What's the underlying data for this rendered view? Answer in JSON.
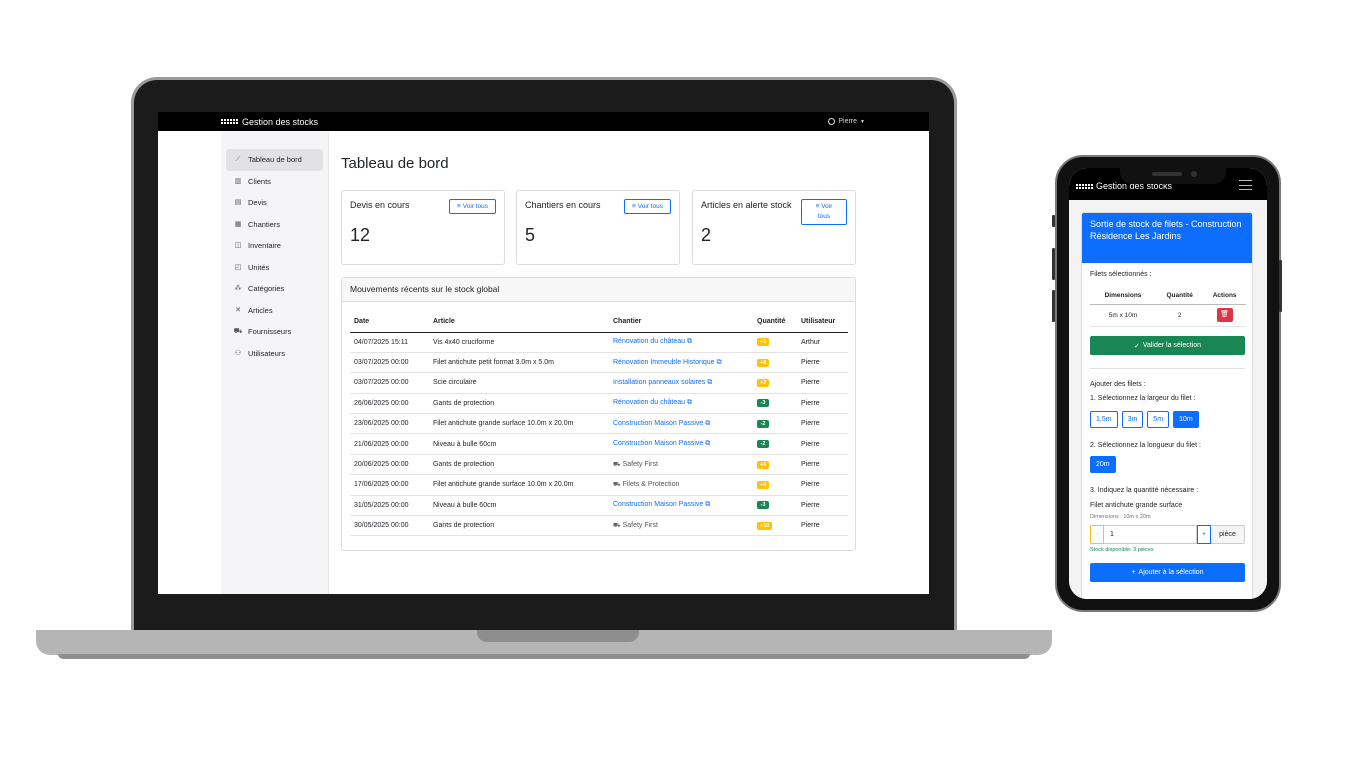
{
  "laptop": {
    "brand": "Gestion des stocks",
    "user": "Pierre",
    "sidebar": [
      {
        "label": "Tableau de bord",
        "icon": "chart-line-icon",
        "glyph": "⟋",
        "active": true
      },
      {
        "label": "Clients",
        "icon": "bar-chart-icon",
        "glyph": "▥"
      },
      {
        "label": "Devis",
        "icon": "document-icon",
        "glyph": "▤"
      },
      {
        "label": "Chantiers",
        "icon": "building-icon",
        "glyph": "▦"
      },
      {
        "label": "Inventaire",
        "icon": "box-icon",
        "glyph": "◫"
      },
      {
        "label": "Unités",
        "icon": "ruler-icon",
        "glyph": "◰"
      },
      {
        "label": "Catégories",
        "icon": "diagram-icon",
        "glyph": "⁂"
      },
      {
        "label": "Articles",
        "icon": "tools-icon",
        "glyph": "✕"
      },
      {
        "label": "Fournisseurs",
        "icon": "truck-icon",
        "glyph": "⛟"
      },
      {
        "label": "Utilisateurs",
        "icon": "users-icon",
        "glyph": "⚇"
      }
    ],
    "page_title": "Tableau de bord",
    "cards": [
      {
        "title": "Devis en cours",
        "value": "12",
        "button": "Voir tous"
      },
      {
        "title": "Chantiers en cours",
        "value": "5",
        "button": "Voir tous"
      },
      {
        "title": "Articles en alerte stock",
        "value": "2",
        "button_line1": "Voir",
        "button_line2": "tous"
      }
    ],
    "movements": {
      "title": "Mouvements récents sur le stock global",
      "headers": [
        "Date",
        "Article",
        "Chantier",
        "Quantité",
        "Utilisateur"
      ],
      "rows": [
        {
          "date": "04/07/2025 15:11",
          "article": "Vis 4x40 cruciforme",
          "chantier": "Rénovation du château",
          "type": "chantier",
          "qty": "+1",
          "color": "yellow",
          "user": "Arthur"
        },
        {
          "date": "03/07/2025 00:00",
          "article": "Filet antichute petit format 3.0m x 5.0m",
          "chantier": "Rénovation Immeuble Historique",
          "type": "chantier",
          "qty": "+8",
          "color": "yellow",
          "user": "Pierre"
        },
        {
          "date": "03/07/2025 00:00",
          "article": "Scie circulaire",
          "chantier": "Installation panneaux solaires",
          "type": "chantier",
          "qty": "+2",
          "color": "yellow",
          "user": "Pierre"
        },
        {
          "date": "26/06/2025 00:00",
          "article": "Gants de protection",
          "chantier": "Rénovation du château",
          "type": "chantier",
          "qty": "-3",
          "color": "green",
          "user": "Pierre"
        },
        {
          "date": "23/06/2025 00:00",
          "article": "Filet antichute grande surface 10.0m x 20.0m",
          "chantier": "Construction Maison Passive",
          "type": "chantier",
          "qty": "-2",
          "color": "green",
          "user": "Pierre"
        },
        {
          "date": "21/06/2025 00:00",
          "article": "Niveau à bulle 60cm",
          "chantier": "Construction Maison Passive",
          "type": "chantier",
          "qty": "-2",
          "color": "green",
          "user": "Pierre"
        },
        {
          "date": "20/06/2025 00:00",
          "article": "Gants de protection",
          "chantier": "Safety First",
          "type": "supplier",
          "qty": "+6",
          "color": "yellow",
          "user": "Pierre"
        },
        {
          "date": "17/06/2025 00:00",
          "article": "Filet antichute grande surface 10.0m x 20.0m",
          "chantier": "Filets & Protection",
          "type": "supplier",
          "qty": "+4",
          "color": "yellow",
          "user": "Pierre"
        },
        {
          "date": "31/05/2025 00:00",
          "article": "Niveau à bulle 60cm",
          "chantier": "Construction Maison Passive",
          "type": "chantier",
          "qty": "-3",
          "color": "green",
          "user": "Pierre"
        },
        {
          "date": "30/05/2025 00:00",
          "article": "Gants de protection",
          "chantier": "Safety First",
          "type": "supplier",
          "qty": "+10",
          "color": "yellow",
          "user": "Pierre"
        }
      ]
    }
  },
  "phone": {
    "brand": "Gestion des stocks",
    "card_title": "Sortie de stock de filets - Construction Résidence Les Jardins",
    "selected_label": "Filets sélectionnés :",
    "table_headers": [
      "Dimensions",
      "Quantité",
      "Actions"
    ],
    "selected_rows": [
      {
        "dimensions": "5m x 10m",
        "qty": "2"
      }
    ],
    "validate_button": "Valider la sélection",
    "add_label": "Ajouter des filets :",
    "step1": "1. Sélectionnez la largeur du filet :",
    "widths": [
      {
        "label": "1,5m"
      },
      {
        "label": "3m"
      },
      {
        "label": "5m"
      },
      {
        "label": "10m",
        "active": true
      }
    ],
    "step2": "2. Sélectionnez la longueur du filet :",
    "lengths": [
      {
        "label": "20m",
        "active": true
      }
    ],
    "step3": "3. Indiquez la quantité nécessaire :",
    "product_name": "Filet antichute grande surface",
    "product_dims": "Dimensions : 10m x 20m",
    "qty_minus": "-",
    "qty_value": "1",
    "qty_plus": "+",
    "qty_unit": "pièce",
    "stock_text": "Stock disponible: 3 pièces",
    "add_button": "Ajouter à la sélection"
  },
  "colors": {
    "primary": "#0d6efd",
    "success": "#198754",
    "warning": "#ffc107",
    "danger": "#dc3545",
    "navbar": "#000000"
  }
}
